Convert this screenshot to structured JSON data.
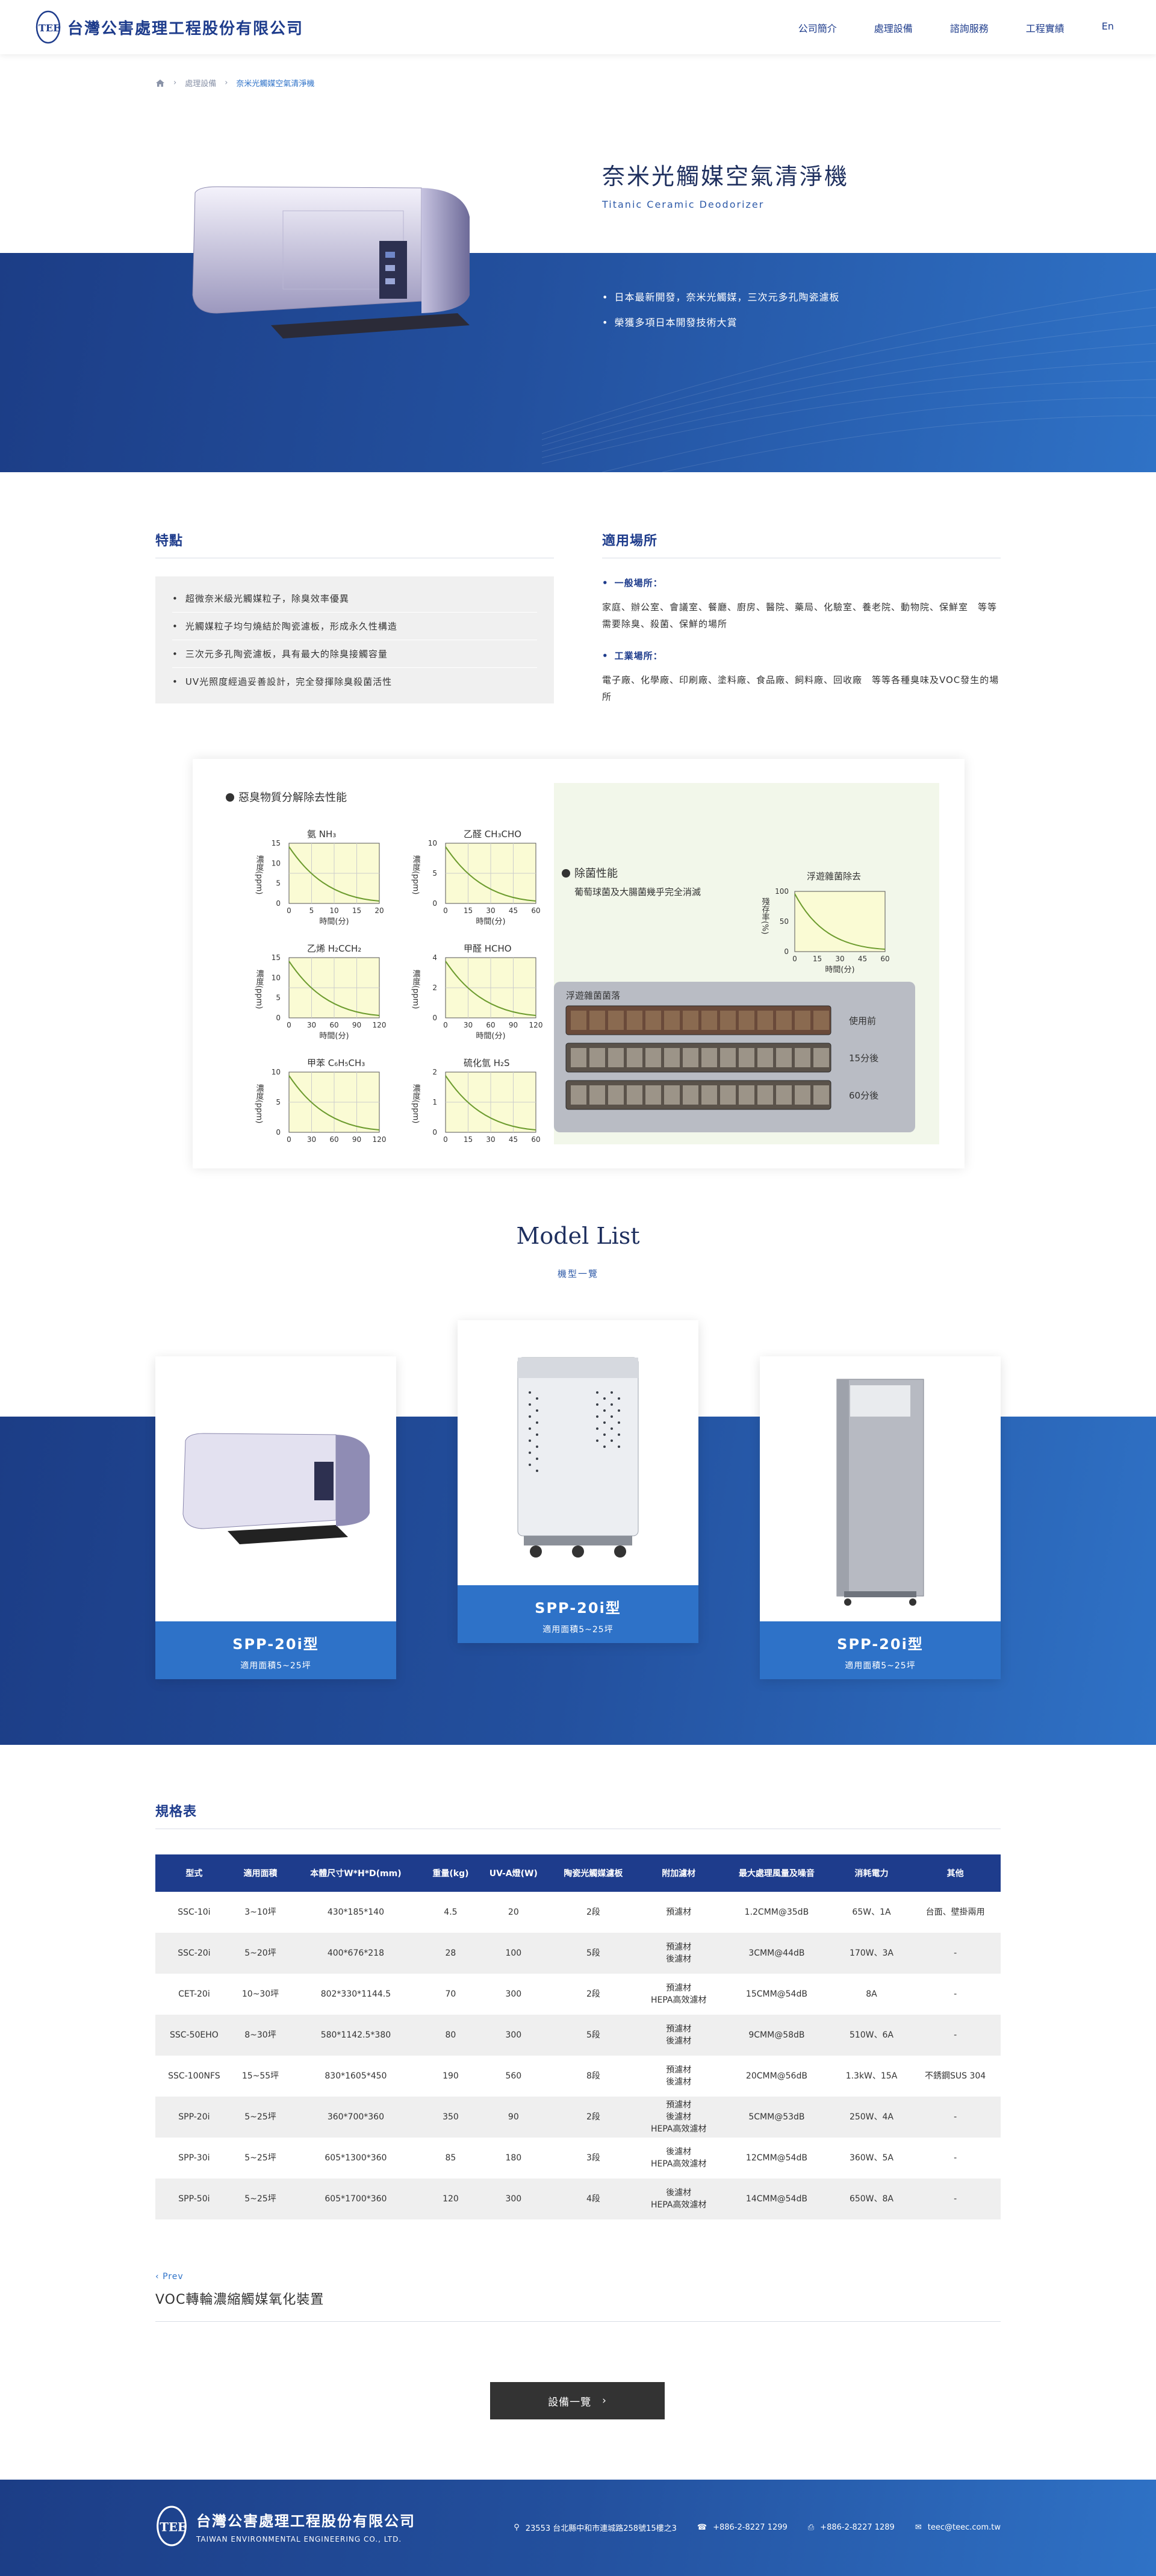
{
  "header": {
    "logo_text": "台灣公害處理工程股份有限公司",
    "nav": [
      "公司簡介",
      "處理設備",
      "諮詢服務",
      "工程實績",
      "En"
    ]
  },
  "breadcrumb": {
    "level1": "處理設備",
    "current": "奈米光觸媒空氣清淨機"
  },
  "hero": {
    "title": "奈米光觸媒空氣清淨機",
    "subtitle": "Titanic Ceramic Deodorizer",
    "bullets": [
      "日本最新開發，奈米光觸媒，三次元多孔陶瓷濾板",
      "榮獲多項日本開發技術大賞"
    ]
  },
  "features": {
    "title": "特點",
    "items": [
      "超微奈米級光觸媒粒子，除臭效率優異",
      "光觸媒粒子均勻燒結於陶瓷濾板，形成永久性構造",
      "三次元多孔陶瓷濾板，具有最大的除臭接觸容量",
      "UV光照度經過妥善設計，完全發揮除臭殺菌活性"
    ]
  },
  "places": {
    "title": "適用場所",
    "groups": [
      {
        "label": "一般場所：",
        "text": "家庭、辦公室、會議室、餐廳、廚房、醫院、藥局、化驗室、養老院、動物院、保鮮室　等等需要除臭、殺菌、保鮮的場所"
      },
      {
        "label": "工業場所：",
        "text": "電子廠、化學廠、印刷廠、塗料廠、食品廠、飼料廠、回收廠　等等各種臭味及VOC發生的場所"
      }
    ]
  },
  "perf": {
    "heading_odor": "惡臭物質分解除去性能",
    "heading_bact": "除菌性能",
    "bact_desc": "葡萄球菌及大腸菌幾乎完全消滅",
    "airborne_title": "浮遊雜菌除去",
    "airborne_ylabel": "殘存率(%)",
    "plate_title": "浮遊雜菌菌落",
    "plate_labels": [
      "使用前",
      "15分後",
      "60分後"
    ],
    "time_label": "時間(分)",
    "conc_label": "濃度(ppm)",
    "charts": [
      {
        "name": "氨 NH₃",
        "ymax": "15",
        "yticks": [
          "15",
          "10",
          "5",
          "0"
        ],
        "xticks": [
          "0",
          "5",
          "10",
          "15",
          "20"
        ]
      },
      {
        "name": "乙醛 CH₃CHO",
        "ymax": "10",
        "yticks": [
          "10",
          "5",
          "0"
        ],
        "xticks": [
          "0",
          "15",
          "30",
          "45",
          "60"
        ]
      },
      {
        "name": "乙烯 H₂CCH₂",
        "ymax": "15",
        "yticks": [
          "15",
          "10",
          "5",
          "0"
        ],
        "xticks": [
          "0",
          "30",
          "60",
          "90",
          "120"
        ]
      },
      {
        "name": "甲醛 HCHO",
        "ymax": "4",
        "yticks": [
          "4",
          "2",
          "0"
        ],
        "xticks": [
          "0",
          "30",
          "60",
          "90",
          "120"
        ]
      },
      {
        "name": "甲苯 C₆H₅CH₃",
        "ymax": "10",
        "yticks": [
          "10",
          "5",
          "0"
        ],
        "xticks": [
          "0",
          "30",
          "60",
          "90",
          "120"
        ]
      },
      {
        "name": "硫化氫 H₂S",
        "ymax": "2",
        "yticks": [
          "2",
          "1",
          "0"
        ],
        "xticks": [
          "0",
          "15",
          "30",
          "45",
          "60"
        ]
      }
    ],
    "airborne_yticks": [
      "100",
      "50",
      "0"
    ],
    "airborne_xticks": [
      "0",
      "15",
      "30",
      "45",
      "60"
    ]
  },
  "model_list": {
    "title": "Model List",
    "subtitle": "機型一覽",
    "cards": [
      {
        "name": "SPP-20i型",
        "area": "適用面積5~25坪"
      },
      {
        "name": "SPP-20i型",
        "area": "適用面積5~25坪"
      },
      {
        "name": "SPP-20i型",
        "area": "適用面積5~25坪"
      }
    ]
  },
  "spec": {
    "title": "規格表",
    "headers": [
      "型式",
      "適用面積",
      "本體尺寸W*H*D(mm)",
      "重量(kg)",
      "UV-A燈(W)",
      "陶瓷光觸媒濾板",
      "附加濾材",
      "最大處理風量及噪音",
      "消耗電力",
      "其他"
    ],
    "rows": [
      [
        "SSC-10i",
        "3~10坪",
        "430*185*140",
        "4.5",
        "20",
        "2段",
        "預濾材",
        "1.2CMM@35dB",
        "65W、1A",
        "台面、壁掛兩用"
      ],
      [
        "SSC-20i",
        "5~20坪",
        "400*676*218",
        "28",
        "100",
        "5段",
        "預濾材\n後濾材",
        "3CMM@44dB",
        "170W、3A",
        "-"
      ],
      [
        "CET-20i",
        "10~30坪",
        "802*330*1144.5",
        "70",
        "300",
        "2段",
        "預濾材\nHEPA高效濾材",
        "15CMM@54dB",
        "8A",
        "-"
      ],
      [
        "SSC-50EHO",
        "8~30坪",
        "580*1142.5*380",
        "80",
        "300",
        "5段",
        "預濾材\n後濾材",
        "9CMM@58dB",
        "510W、6A",
        "-"
      ],
      [
        "SSC-100NFS",
        "15~55坪",
        "830*1605*450",
        "190",
        "560",
        "8段",
        "預濾材\n後濾材",
        "20CMM@56dB",
        "1.3kW、15A",
        "不銹鋼SUS 304"
      ],
      [
        "SPP-20i",
        "5~25坪",
        "360*700*360",
        "350",
        "90",
        "2段",
        "預濾材\n後濾材\nHEPA高效濾材",
        "5CMM@53dB",
        "250W、4A",
        "-"
      ],
      [
        "SPP-30i",
        "5~25坪",
        "605*1300*360",
        "85",
        "180",
        "3段",
        "後濾材\nHEPA高效濾材",
        "12CMM@54dB",
        "360W、5A",
        "-"
      ],
      [
        "SPP-50i",
        "5~25坪",
        "605*1700*360",
        "120",
        "300",
        "4段",
        "後濾材\nHEPA高效濾材",
        "14CMM@54dB",
        "650W、8A",
        "-"
      ]
    ]
  },
  "prev": {
    "label": "Prev",
    "title": "VOC轉輪濃縮觸媒氧化裝置"
  },
  "all_button": "設備一覽",
  "footer": {
    "name": "台灣公害處理工程股份有限公司",
    "en": "TAIWAN ENVIRONMENTAL ENGINEERING CO., LTD.",
    "address": "23553 台北縣中和市連城路258號15樓之3",
    "phone": "+886-2-8227 1299",
    "fax": "+886-2-8227 1289",
    "email": "teec@teec.com.tw"
  },
  "colors": {
    "primary": "#1e3c8c",
    "accent": "#2e72c8",
    "button": "#333333"
  }
}
